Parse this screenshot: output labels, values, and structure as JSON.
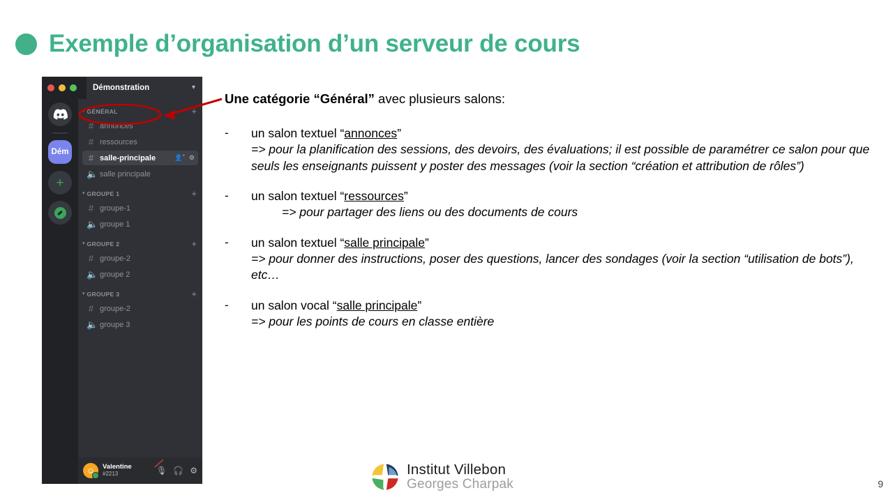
{
  "slide": {
    "heading": "Exemple d’organisation d’un serveur de cours",
    "bullet_color": "#42b088",
    "heading_color": "#3fb28b",
    "page_number": "9"
  },
  "discord": {
    "window_title": "Démonstration",
    "titlebar": {
      "close_dot": "close-dot",
      "minimize_dot": "minimize-dot",
      "maximize_dot": "maximize-dot",
      "chevron": "▼"
    },
    "rail": {
      "home_icon": "discord-logo",
      "selected_server_label": "Dém",
      "add_server_label": "+",
      "explore_label": "compass"
    },
    "categories": [
      {
        "name": "GÉNÉRAL",
        "arrow": "▾",
        "add": "+",
        "channels": [
          {
            "type": "text",
            "icon": "#",
            "name": "annonces",
            "active": false
          },
          {
            "type": "text",
            "icon": "#",
            "name": "ressources",
            "active": false
          },
          {
            "type": "text",
            "icon": "#",
            "name": "salle-principale",
            "active": true,
            "actions": [
              "invite-icon",
              "settings-icon"
            ]
          },
          {
            "type": "voice",
            "icon": "🔊",
            "name": "salle principale",
            "active": false
          }
        ]
      },
      {
        "name": "GROUPE 1",
        "arrow": "▾",
        "add": "+",
        "channels": [
          {
            "type": "text",
            "icon": "#",
            "name": "groupe-1",
            "active": false
          },
          {
            "type": "voice",
            "icon": "🔊",
            "name": "groupe 1",
            "active": false
          }
        ]
      },
      {
        "name": "GROUPE 2",
        "arrow": "▾",
        "add": "+",
        "channels": [
          {
            "type": "text",
            "icon": "#",
            "name": "groupe-2",
            "active": false
          },
          {
            "type": "voice",
            "icon": "🔊",
            "name": "groupe 2",
            "active": false
          }
        ]
      },
      {
        "name": "GROUPE 3",
        "arrow": "▾",
        "add": "+",
        "channels": [
          {
            "type": "text",
            "icon": "#",
            "name": "groupe-2",
            "active": false
          },
          {
            "type": "voice",
            "icon": "🔊",
            "name": "groupe 3",
            "active": false
          }
        ]
      }
    ],
    "userbar": {
      "username": "Valentine",
      "discriminator": "#2213",
      "mic_icon": "microphone-muted-icon",
      "headphones_icon": "headphones-icon",
      "settings_icon": "gear-icon"
    }
  },
  "annotation": {
    "color": "#c00000",
    "target": "GÉNÉRAL"
  },
  "content": {
    "lead_bold": "Une catégorie “Général”",
    "lead_rest": " avec plusieurs salons:",
    "bullets": [
      {
        "dash": "-",
        "title_prefix": "un salon textuel “",
        "title_underlined": "annonces",
        "title_suffix": "”",
        "desc": "=> pour la planification des sessions, des devoirs, des évaluations; il est possible de paramétrer ce salon pour que seuls les enseignants puissent y poster des messages (voir la section “création et attribution de rôles”)",
        "desc_indented": false
      },
      {
        "dash": "-",
        "title_prefix": "un salon textuel “",
        "title_underlined": "ressources",
        "title_suffix": "”",
        "desc": "=> pour partager des liens ou des documents de cours",
        "desc_indented": true
      },
      {
        "dash": "-",
        "title_prefix": "un salon textuel “",
        "title_underlined": "salle principale",
        "title_suffix": "”",
        "desc": "=> pour donner des instructions, poser des questions, lancer des sondages (voir la section “utilisation de bots”), etc…",
        "desc_indented": false
      },
      {
        "dash": "-",
        "title_prefix": "un salon vocal “",
        "title_underlined": "salle principale",
        "title_suffix": "”",
        "desc": "=> pour les points de cours en classe entière",
        "desc_indented": false
      }
    ]
  },
  "footer": {
    "logo_line1": "Institut Villebon",
    "logo_line2": "Georges Charpak",
    "logo_colors": {
      "yellow": "#f2c438",
      "green": "#4cae61",
      "red": "#cc2a23",
      "navy": "#1f3864",
      "lightblue": "#7ab3d9"
    }
  }
}
